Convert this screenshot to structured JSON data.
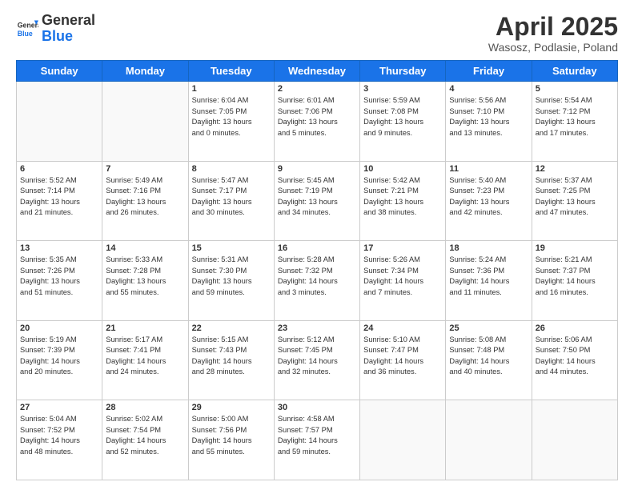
{
  "header": {
    "logo_general": "General",
    "logo_blue": "Blue",
    "month_title": "April 2025",
    "location": "Wasosz, Podlasie, Poland"
  },
  "days_of_week": [
    "Sunday",
    "Monday",
    "Tuesday",
    "Wednesday",
    "Thursday",
    "Friday",
    "Saturday"
  ],
  "weeks": [
    [
      {
        "day": "",
        "info": ""
      },
      {
        "day": "",
        "info": ""
      },
      {
        "day": "1",
        "info": "Sunrise: 6:04 AM\nSunset: 7:05 PM\nDaylight: 13 hours\nand 0 minutes."
      },
      {
        "day": "2",
        "info": "Sunrise: 6:01 AM\nSunset: 7:06 PM\nDaylight: 13 hours\nand 5 minutes."
      },
      {
        "day": "3",
        "info": "Sunrise: 5:59 AM\nSunset: 7:08 PM\nDaylight: 13 hours\nand 9 minutes."
      },
      {
        "day": "4",
        "info": "Sunrise: 5:56 AM\nSunset: 7:10 PM\nDaylight: 13 hours\nand 13 minutes."
      },
      {
        "day": "5",
        "info": "Sunrise: 5:54 AM\nSunset: 7:12 PM\nDaylight: 13 hours\nand 17 minutes."
      }
    ],
    [
      {
        "day": "6",
        "info": "Sunrise: 5:52 AM\nSunset: 7:14 PM\nDaylight: 13 hours\nand 21 minutes."
      },
      {
        "day": "7",
        "info": "Sunrise: 5:49 AM\nSunset: 7:16 PM\nDaylight: 13 hours\nand 26 minutes."
      },
      {
        "day": "8",
        "info": "Sunrise: 5:47 AM\nSunset: 7:17 PM\nDaylight: 13 hours\nand 30 minutes."
      },
      {
        "day": "9",
        "info": "Sunrise: 5:45 AM\nSunset: 7:19 PM\nDaylight: 13 hours\nand 34 minutes."
      },
      {
        "day": "10",
        "info": "Sunrise: 5:42 AM\nSunset: 7:21 PM\nDaylight: 13 hours\nand 38 minutes."
      },
      {
        "day": "11",
        "info": "Sunrise: 5:40 AM\nSunset: 7:23 PM\nDaylight: 13 hours\nand 42 minutes."
      },
      {
        "day": "12",
        "info": "Sunrise: 5:37 AM\nSunset: 7:25 PM\nDaylight: 13 hours\nand 47 minutes."
      }
    ],
    [
      {
        "day": "13",
        "info": "Sunrise: 5:35 AM\nSunset: 7:26 PM\nDaylight: 13 hours\nand 51 minutes."
      },
      {
        "day": "14",
        "info": "Sunrise: 5:33 AM\nSunset: 7:28 PM\nDaylight: 13 hours\nand 55 minutes."
      },
      {
        "day": "15",
        "info": "Sunrise: 5:31 AM\nSunset: 7:30 PM\nDaylight: 13 hours\nand 59 minutes."
      },
      {
        "day": "16",
        "info": "Sunrise: 5:28 AM\nSunset: 7:32 PM\nDaylight: 14 hours\nand 3 minutes."
      },
      {
        "day": "17",
        "info": "Sunrise: 5:26 AM\nSunset: 7:34 PM\nDaylight: 14 hours\nand 7 minutes."
      },
      {
        "day": "18",
        "info": "Sunrise: 5:24 AM\nSunset: 7:36 PM\nDaylight: 14 hours\nand 11 minutes."
      },
      {
        "day": "19",
        "info": "Sunrise: 5:21 AM\nSunset: 7:37 PM\nDaylight: 14 hours\nand 16 minutes."
      }
    ],
    [
      {
        "day": "20",
        "info": "Sunrise: 5:19 AM\nSunset: 7:39 PM\nDaylight: 14 hours\nand 20 minutes."
      },
      {
        "day": "21",
        "info": "Sunrise: 5:17 AM\nSunset: 7:41 PM\nDaylight: 14 hours\nand 24 minutes."
      },
      {
        "day": "22",
        "info": "Sunrise: 5:15 AM\nSunset: 7:43 PM\nDaylight: 14 hours\nand 28 minutes."
      },
      {
        "day": "23",
        "info": "Sunrise: 5:12 AM\nSunset: 7:45 PM\nDaylight: 14 hours\nand 32 minutes."
      },
      {
        "day": "24",
        "info": "Sunrise: 5:10 AM\nSunset: 7:47 PM\nDaylight: 14 hours\nand 36 minutes."
      },
      {
        "day": "25",
        "info": "Sunrise: 5:08 AM\nSunset: 7:48 PM\nDaylight: 14 hours\nand 40 minutes."
      },
      {
        "day": "26",
        "info": "Sunrise: 5:06 AM\nSunset: 7:50 PM\nDaylight: 14 hours\nand 44 minutes."
      }
    ],
    [
      {
        "day": "27",
        "info": "Sunrise: 5:04 AM\nSunset: 7:52 PM\nDaylight: 14 hours\nand 48 minutes."
      },
      {
        "day": "28",
        "info": "Sunrise: 5:02 AM\nSunset: 7:54 PM\nDaylight: 14 hours\nand 52 minutes."
      },
      {
        "day": "29",
        "info": "Sunrise: 5:00 AM\nSunset: 7:56 PM\nDaylight: 14 hours\nand 55 minutes."
      },
      {
        "day": "30",
        "info": "Sunrise: 4:58 AM\nSunset: 7:57 PM\nDaylight: 14 hours\nand 59 minutes."
      },
      {
        "day": "",
        "info": ""
      },
      {
        "day": "",
        "info": ""
      },
      {
        "day": "",
        "info": ""
      }
    ]
  ]
}
